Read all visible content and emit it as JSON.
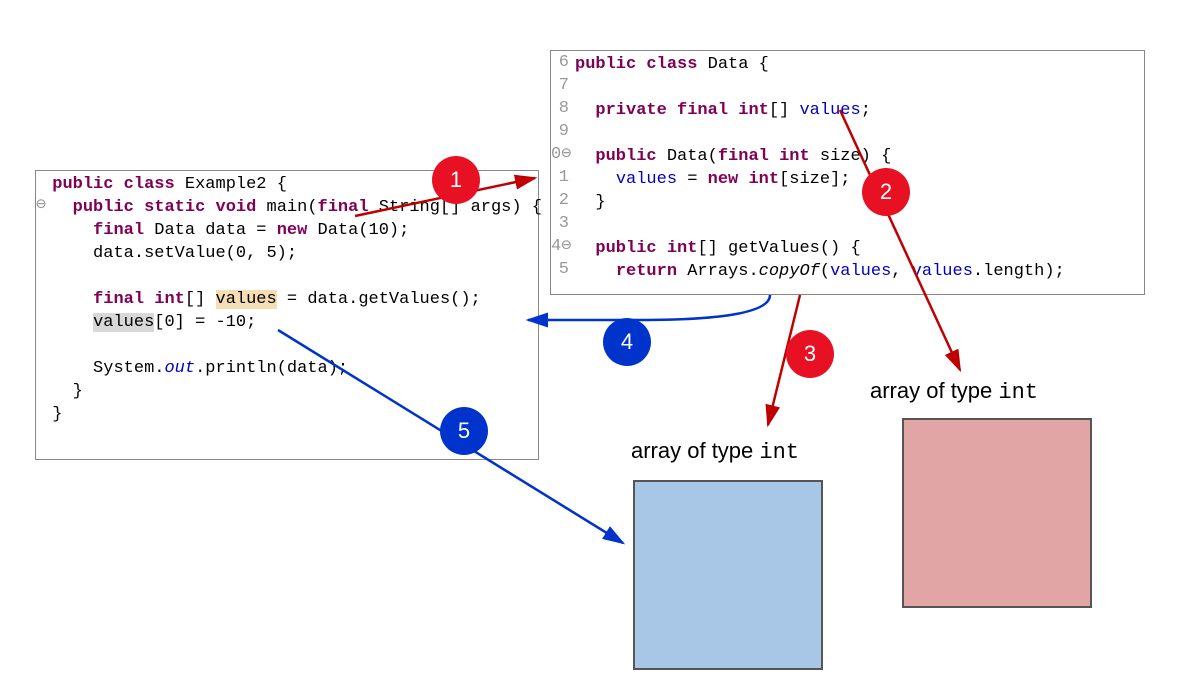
{
  "left_code": {
    "l1_public": "public",
    "l1_class": "class",
    "l1_name": " Example2 {",
    "l2_indent": "  ",
    "l2_public": "public",
    "l2_static": "static",
    "l2_void": "void",
    "l2_main": " main(",
    "l2_final": "final",
    "l2_rest": " String[] args) {",
    "l3_indent": "    ",
    "l3_final": "final",
    "l3_mid": " Data data = ",
    "l3_new": "new",
    "l3_end": " Data(10);",
    "l4": "    data.setValue(0, 5);",
    "l5_indent": "    ",
    "l5_final": "final",
    "l5_sp": " ",
    "l5_int": "int",
    "l5_br": "[] ",
    "l5_values": "values",
    "l5_rest": " = data.getValues();",
    "l6_pre": "    ",
    "l6_values": "values",
    "l6_rest": "[0] = -10;",
    "l7_pre": "    System.",
    "l7_out": "out",
    "l7_rest": ".println(data);",
    "l8": "  }",
    "l9": "}"
  },
  "right_code": {
    "ln6": "6",
    "ln7": "7",
    "ln8": "8",
    "ln9": "9",
    "ln10": "0",
    "ln11": "1",
    "ln12": "2",
    "ln13": "3",
    "ln14": "4",
    "ln15": "5",
    "l1_public": "public",
    "l1_class": "class",
    "l1_rest": " Data {",
    "l2_indent": "  ",
    "l2_private": "private",
    "l2_final": "final",
    "l2_int": "int",
    "l2_rest": "[] ",
    "l2_values": "values",
    "l2_semi": ";",
    "l3_indent": "  ",
    "l3_public": "public",
    "l3_name": " Data(",
    "l3_final": "final",
    "l3_sp": " ",
    "l3_int": "int",
    "l3_rest": " size) {",
    "l4_pre": "    ",
    "l4_values": "values",
    "l4_eq": " = ",
    "l4_new": "new",
    "l4_sp": " ",
    "l4_int": "int",
    "l4_rest": "[size];",
    "l5": "  }",
    "l6_indent": "  ",
    "l6_public": "public",
    "l6_sp": " ",
    "l6_int": "int",
    "l6_rest": "[] getValues() {",
    "l7_indent": "    ",
    "l7_return": "return",
    "l7_mid": " Arrays.",
    "l7_copy": "copyOf",
    "l7_open": "(",
    "l7_values1": "values",
    "l7_comma": ", ",
    "l7_values2": "values",
    "l7_len": ".length);"
  },
  "badges": {
    "b1": "1",
    "b2": "2",
    "b3": "3",
    "b4": "4",
    "b5": "5"
  },
  "labels": {
    "left_text": "array of type ",
    "left_mono": "int",
    "right_text": "array of type ",
    "right_mono": "int"
  }
}
